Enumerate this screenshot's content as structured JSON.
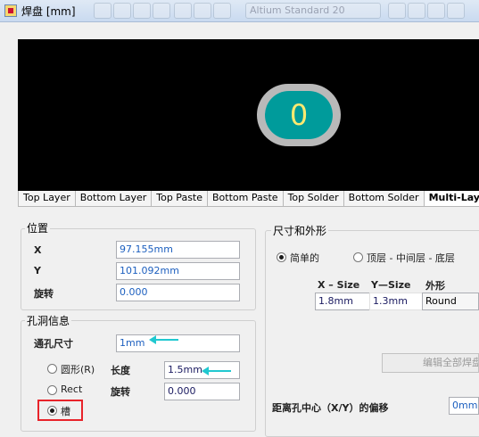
{
  "window": {
    "title": "焊盘 [mm]",
    "background_toolbar_text": "Altium Standard 20"
  },
  "preview": {
    "pad_label": "0",
    "colors": {
      "pad_fill": "#009b9b",
      "pad_ring": "#b9b9b9",
      "label": "#ffea70",
      "background": "#000000"
    }
  },
  "tabs": [
    {
      "label": "Top Layer",
      "active": false
    },
    {
      "label": "Bottom Layer",
      "active": false
    },
    {
      "label": "Top Paste",
      "active": false
    },
    {
      "label": "Bottom Paste",
      "active": false
    },
    {
      "label": "Top Solder",
      "active": false
    },
    {
      "label": "Bottom Solder",
      "active": false
    },
    {
      "label": "Multi-Layer",
      "active": true
    }
  ],
  "position": {
    "title": "位置",
    "x_label": "X",
    "x_value": "97.155mm",
    "y_label": "Y",
    "y_value": "101.092mm",
    "rotation_label": "旋转",
    "rotation_value": "0.000"
  },
  "hole": {
    "title": "孔洞信息",
    "size_label": "通孔尺寸",
    "size_value": "1mm",
    "round_label": "圆形(R)",
    "rect_label": "Rect",
    "slot_label": "槽",
    "selected": "slot",
    "length_label": "长度",
    "length_value": "1.5mm",
    "rotation_label": "旋转",
    "rotation_value": "0.000"
  },
  "size_shape": {
    "title": "尺寸和外形",
    "simple_label": "简单的",
    "top_mid_bottom_label": "顶层 - 中间层 - 底层",
    "selected": "simple",
    "x_size_header": "X – Size",
    "y_size_header": "Y—Size",
    "shape_header": "外形",
    "x_size_value": "1.8mm",
    "y_size_value": "1.3mm",
    "shape_value": "Round",
    "edit_all_button": "编辑全部焊盘层定义...",
    "offset_label": "距离孔中心（X/Y）的偏移",
    "offset_value": "0mm"
  },
  "annotations": {
    "arrow_color": "#21c8d0",
    "highlight_color": "#e8232a"
  }
}
